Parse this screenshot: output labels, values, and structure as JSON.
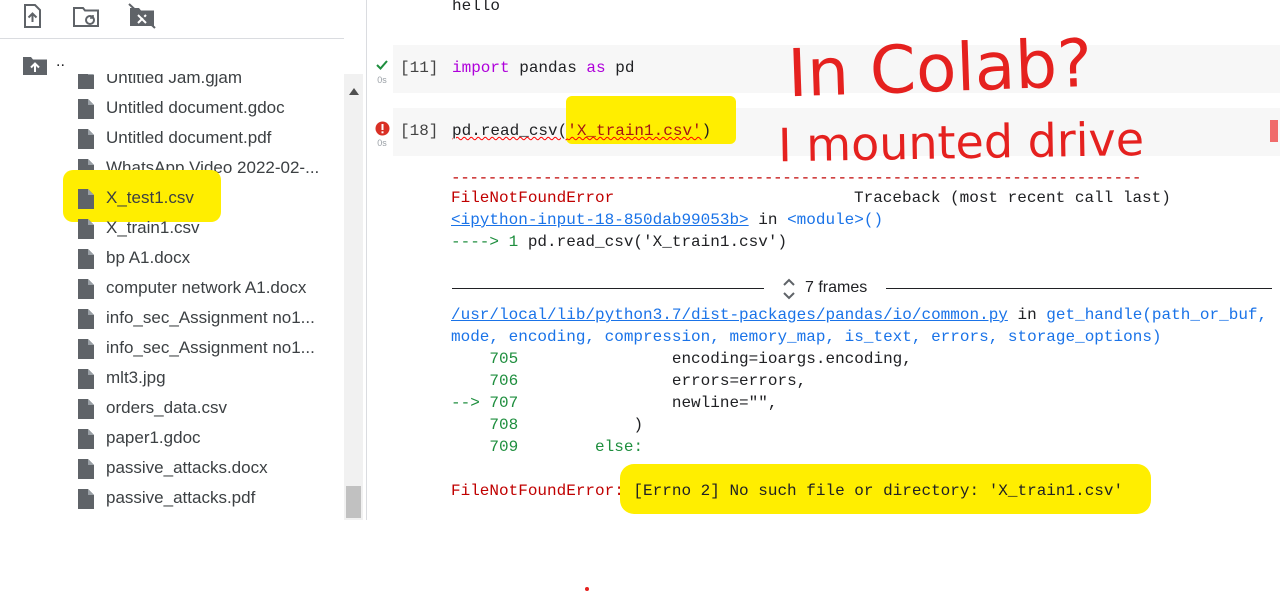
{
  "sidebar": {
    "parent_label": "..",
    "files": [
      {
        "name": "Untitled Jam.gjam",
        "icon": "file-icon"
      },
      {
        "name": "Untitled document.gdoc",
        "icon": "file-icon"
      },
      {
        "name": "Untitled document.pdf",
        "icon": "file-icon"
      },
      {
        "name": "WhatsApp Video 2022-02-...",
        "icon": "file-icon"
      },
      {
        "name": "X_test1.csv",
        "icon": "file-icon"
      },
      {
        "name": "X_train1.csv",
        "icon": "file-icon"
      },
      {
        "name": "bp A1.docx",
        "icon": "file-icon"
      },
      {
        "name": "computer network A1.docx",
        "icon": "file-icon"
      },
      {
        "name": "info_sec_Assignment no1...",
        "icon": "file-icon"
      },
      {
        "name": "info_sec_Assignment no1...",
        "icon": "file-icon"
      },
      {
        "name": "mlt3.jpg",
        "icon": "file-icon"
      },
      {
        "name": "orders_data.csv",
        "icon": "file-icon"
      },
      {
        "name": "paper1.gdoc",
        "icon": "file-icon"
      },
      {
        "name": "passive_attacks.docx",
        "icon": "file-icon"
      },
      {
        "name": "passive_attacks.pdf",
        "icon": "file-icon"
      }
    ]
  },
  "notebook": {
    "prev_output": "hello",
    "cell1": {
      "count": "[11]",
      "status_time": "0s",
      "code_kw1": "import",
      "code_mid": " pandas ",
      "code_kw2": "as",
      "code_end": " pd"
    },
    "cell2": {
      "count": "[18]",
      "status_time": "0s",
      "code_func": "pd.read_csv(",
      "code_arg": "'X_train1.csv'",
      "code_close": ")"
    },
    "output": {
      "dashes": "---------------------------------------------------------------------------",
      "error_name": "FileNotFoundError",
      "traceback_label": "Traceback (most recent call last)",
      "input_ref": "<ipython-input-18-850dab99053b>",
      "in_word": " in ",
      "module_ref": "<module>()",
      "arrow_line_prefix": "----> 1 ",
      "arrow_line_code": "pd.read_csv('X_train1.csv')",
      "frames_label": "7 frames",
      "path": "/usr/local/lib/python3.7/dist-packages/pandas/io/common.py",
      "func": "get_handle(path_or_buf,",
      "func_args": "mode, encoding, compression, memory_map, is_text, errors, storage_options)",
      "lines": [
        {
          "num": "    705",
          "code": "                encoding=ioargs.encoding,"
        },
        {
          "num": "    706",
          "code": "                errors=errors,"
        },
        {
          "num": "--> 707",
          "code": "                newline=\"\","
        },
        {
          "num": "    708",
          "code": "            )"
        },
        {
          "num": "    709",
          "code": "        else:"
        }
      ],
      "final_error_name": "FileNotFoundError:",
      "final_error_msg": " [Errno 2] No such file or directory: 'X_train1.csv'"
    }
  },
  "annotation": {
    "line1": "In Colab?",
    "line2": "I mounted drive",
    "color": "#e5211f"
  },
  "colors": {
    "highlight": "#ffee00",
    "success": "#1e8e3e",
    "error": "#d93025",
    "link": "#1a73e8"
  }
}
